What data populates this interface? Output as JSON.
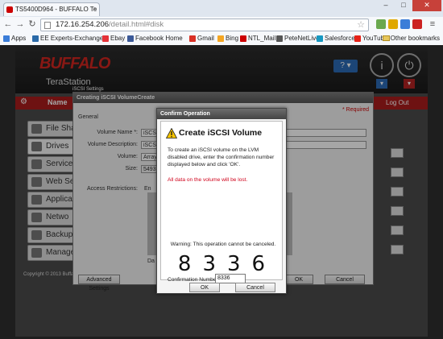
{
  "browser": {
    "tab_title": "TS5400D964 - BUFFALO Te",
    "url_host": "172.16.254.206",
    "url_path": "/detail.html#disk",
    "bookmarks": [
      {
        "label": "Apps",
        "color": "#3b7dd8"
      },
      {
        "label": "EE Experts-Exchange",
        "color": "#2b6aa8"
      },
      {
        "label": "Ebay",
        "color": "#e53238"
      },
      {
        "label": "Facebook Home",
        "color": "#3b5998"
      },
      {
        "label": "Gmail",
        "color": "#d93025"
      },
      {
        "label": "Bing",
        "color": "#f5a623"
      },
      {
        "label": "NTL_Mail",
        "color": "#c00"
      },
      {
        "label": "PeteNetLive",
        "color": "#555"
      },
      {
        "label": "Salesforce",
        "color": "#1798c1"
      },
      {
        "label": "YouTube",
        "color": "#e62117"
      }
    ],
    "other_bookmarks": "Other bookmarks"
  },
  "app": {
    "logo": "BUFFALO",
    "product": "TeraStation",
    "help_label": "?",
    "tab_name_label": "Name",
    "logout_label": "Log Out",
    "sidebar": [
      {
        "label": "File Sha"
      },
      {
        "label": "Drives"
      },
      {
        "label": "Services"
      },
      {
        "label": "Web Se"
      },
      {
        "label": "Applica"
      },
      {
        "label": "Netwo"
      },
      {
        "label": "Backup"
      },
      {
        "label": "Manage"
      }
    ],
    "copyright": "Copyright © 2013 Buffa"
  },
  "create_dialog": {
    "tab_label": "iSCSI Settings",
    "title": "Creating iSCSI VolumeCreate",
    "general": "General",
    "required": "* Required",
    "fields": [
      {
        "label": "Volume Name *:",
        "value": "iSCSI"
      },
      {
        "label": "Volume Description:",
        "value": "iSCSI"
      },
      {
        "label": "Volume:",
        "value": "Array"
      },
      {
        "label": "Size:",
        "value": "5493"
      }
    ],
    "restrictions_label": "Access Restrictions:",
    "restrictions_value": "En",
    "bottom_value": "Da",
    "advanced_btn": "Advanced Settings",
    "ok_btn": "OK",
    "cancel_btn": "Cancel"
  },
  "confirm_dialog": {
    "title": "Confirm Operation",
    "heading": "Create iSCSI Volume",
    "instructions": "To create an iSCSI volume on the LVM disabled drive, enter the confirmation number displayed below and click 'OK'.",
    "data_loss": "All data on the volume will be lost.",
    "caution": "Warning: This operation cannot be canceled.",
    "code_digits": [
      "8",
      "3",
      "3",
      "6"
    ],
    "number_label": "Confirmation Number:",
    "number_value": "8336",
    "ok_btn": "OK",
    "cancel_btn": "Cancel"
  }
}
